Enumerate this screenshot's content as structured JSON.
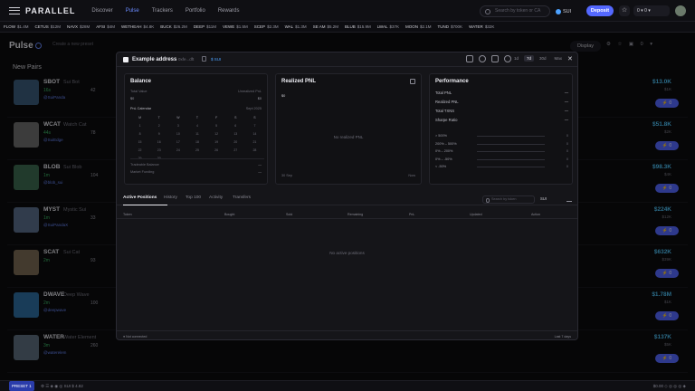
{
  "nav": {
    "brand": "PARALLEL",
    "links": [
      "Discover",
      "Pulse",
      "Trackers",
      "Portfolio",
      "Rewards"
    ],
    "search_placeholder": "Search by token or CA",
    "chain": "SUI",
    "deposit": "Deposit",
    "wallet": "0 ▾ 0 ▾"
  },
  "ticker": [
    {
      "sym": "FLOW",
      "val": "$1.4M",
      "chg": ""
    },
    {
      "sym": "CETUS",
      "val": "$12M",
      "chg": ""
    },
    {
      "sym": "NAVX",
      "val": "$28M",
      "chg": ""
    },
    {
      "sym": "AFSI",
      "val": "$4M",
      "chg": ""
    },
    {
      "sym": "WETHEAH",
      "val": "$4.8K",
      "chg": ""
    },
    {
      "sym": "BUCK",
      "val": "$26.2M",
      "chg": ""
    },
    {
      "sym": "DEEP",
      "val": "$11M",
      "chg": ""
    },
    {
      "sym": "VEWE",
      "val": "$1.5M",
      "chg": ""
    },
    {
      "sym": "SCEP",
      "val": "$2.3M",
      "chg": ""
    },
    {
      "sym": "WAL",
      "val": "$1.3M",
      "chg": ""
    },
    {
      "sym": "SE AM",
      "val": "$5.2M",
      "chg": ""
    },
    {
      "sym": "BLUB",
      "val": "$15.9M",
      "chg": ""
    },
    {
      "sym": "LWAL",
      "val": "$37K",
      "chg": ""
    },
    {
      "sym": "MOON",
      "val": "$2.1M",
      "chg": ""
    },
    {
      "sym": "TUND",
      "val": "$700K",
      "chg": ""
    },
    {
      "sym": "WATER",
      "val": "$32K",
      "chg": ""
    }
  ],
  "page": {
    "title": "Pulse",
    "preset": "Create a new preset",
    "display": "Display",
    "right_icons": "⚙ ☆ ▣ 0 ▾",
    "column_title": "New Pairs"
  },
  "tokens": [
    {
      "sym": "SBOT",
      "name": "Sui Bot",
      "age": "16s",
      "holders": "42",
      "handle": "@SuiPanda",
      "mc": "$13.0K",
      "vol": "$1K",
      "color": "#3b5b7a"
    },
    {
      "sym": "WCAT",
      "name": "Watch Cat",
      "age": "44s",
      "holders": "78",
      "handle": "@SuiEdge",
      "mc": "$51.8K",
      "vol": "$2K",
      "color": "#6e6e6e"
    },
    {
      "sym": "BLOB",
      "name": "Sui Blob",
      "age": "1m",
      "holders": "104",
      "handle": "@blob_sui",
      "mc": "$98.3K",
      "vol": "$4K",
      "color": "#3d6b50"
    },
    {
      "sym": "MYST",
      "name": "Mystic Sui",
      "age": "1m",
      "holders": "33",
      "handle": "@SuiPandaX",
      "mc": "$224K",
      "vol": "$12K",
      "color": "#5a6e8a"
    },
    {
      "sym": "SCAT",
      "name": "Sui Cat",
      "age": "2m",
      "holders": "93",
      "handle": "",
      "mc": "$632K",
      "vol": "$39K",
      "color": "#7a6a55"
    },
    {
      "sym": "DWAVE",
      "name": "Deep Wave",
      "age": "2m",
      "holders": "100",
      "handle": "@deepwave",
      "mc": "$1.78M",
      "vol": "$1K",
      "color": "#2f6ea1"
    },
    {
      "sym": "WATER",
      "name": "Water Element",
      "age": "3m",
      "holders": "260",
      "handle": "@waterelem",
      "mc": "$137K",
      "vol": "$5K",
      "color": "#5d6e7f"
    }
  ],
  "modal": {
    "title": "Example address",
    "address": "0xfe...dft",
    "balance": "$ SUI",
    "timeframes": [
      "1d",
      "7d",
      "30d",
      "Max"
    ],
    "balance_panel": {
      "title": "Balance",
      "total_value_label": "Total Value",
      "total_value": "$0",
      "unrealized_label": "Unrealized PnL",
      "unrealized": "$0",
      "calendar_label": "PnL Calendar",
      "calendar_month": "Sept 2025",
      "weekdays": [
        "M",
        "T",
        "W",
        "T",
        "F",
        "S",
        "S"
      ],
      "days": [
        "1",
        "2",
        "3",
        "4",
        "5",
        "6",
        "7",
        "8",
        "9",
        "10",
        "11",
        "12",
        "13",
        "14",
        "15",
        "16",
        "17",
        "18",
        "19",
        "20",
        "21",
        "22",
        "23",
        "24",
        "25",
        "26",
        "27",
        "28",
        "29",
        "30",
        "",
        "",
        "",
        "",
        ""
      ],
      "tradeable_label": "Tradeable Balance",
      "tradeable": "—",
      "funding_label": "Market Funding",
      "funding": "—"
    },
    "pnl_panel": {
      "title": "Realized PNL",
      "value": "$0",
      "empty": "No realized PNL",
      "x_start": "30 Sep",
      "x_end": "Now"
    },
    "perf_panel": {
      "title": "Performance",
      "rows": [
        {
          "k": "Total PNL",
          "v": "—"
        },
        {
          "k": "Realized PNL",
          "v": "—"
        },
        {
          "k": "Total TXNS",
          "v": "—"
        },
        {
          "k": "Sharpe Ratio",
          "v": "—"
        }
      ],
      "dist": [
        {
          "k": "> 500%",
          "v": "0"
        },
        {
          "k": "200% – 500%",
          "v": "0"
        },
        {
          "k": "0% – 200%",
          "v": "0"
        },
        {
          "k": "0% – -50%",
          "v": "0"
        },
        {
          "k": "< -50%",
          "v": "0"
        }
      ]
    },
    "tabs": [
      "Active Positions",
      "History",
      "Top 100",
      "Activity",
      "Transfers"
    ],
    "search_placeholder": "Search by token",
    "currency": "SUI",
    "columns": [
      "Token",
      "Bought",
      "Sold",
      "Remaining",
      "PnL",
      "Updated",
      "Action"
    ],
    "empty": "No active positions",
    "footer_left": "● Not connected",
    "footer_right": "Last 7 days"
  },
  "status": {
    "badge": "PRESET 1",
    "text": "⚙  ☰  ◈  ◉  ◎  SUI  $ 4.82",
    "right": "$0.00    ◇  ◎  ◎  ◎  ◈"
  }
}
